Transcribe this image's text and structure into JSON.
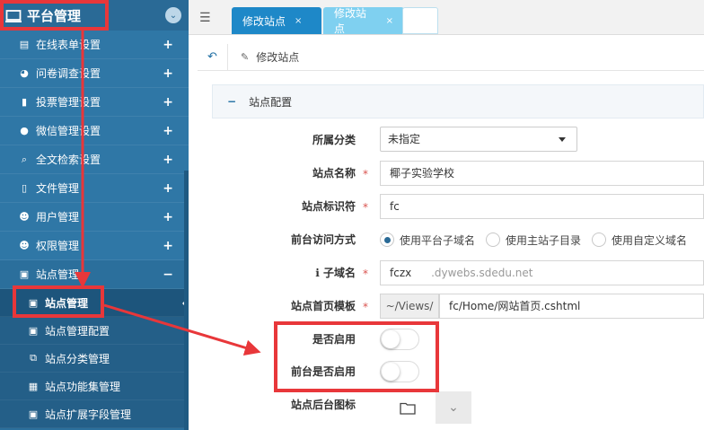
{
  "sidebar": {
    "title": "平台管理",
    "menu": [
      {
        "label": "在线表单设置",
        "icon": "form-icon",
        "glyph": "▤",
        "expand": "+"
      },
      {
        "label": "问卷调查设置",
        "icon": "pie-chart-icon",
        "glyph": "◕",
        "expand": "+"
      },
      {
        "label": "投票管理设置",
        "icon": "bar-chart-icon",
        "glyph": "▮",
        "expand": "+"
      },
      {
        "label": "微信管理设置",
        "icon": "wechat-icon",
        "glyph": "●",
        "expand": "+"
      },
      {
        "label": "全文检索设置",
        "icon": "search-icon",
        "glyph": "⌕",
        "expand": "+"
      },
      {
        "label": "文件管理",
        "icon": "file-icon",
        "glyph": "▯",
        "expand": "+"
      },
      {
        "label": "用户管理",
        "icon": "user-icon",
        "glyph": "☻",
        "expand": "+"
      },
      {
        "label": "权限管理",
        "icon": "permission-icon",
        "glyph": "☻",
        "expand": "+"
      },
      {
        "label": "站点管理",
        "icon": "site-icon",
        "glyph": "▣",
        "expand": "−"
      }
    ],
    "submenu": [
      {
        "label": "站点管理",
        "icon": "site-manage-icon",
        "glyph": "▣"
      },
      {
        "label": "站点管理配置",
        "icon": "site-config-icon",
        "glyph": "▣"
      },
      {
        "label": "站点分类管理",
        "icon": "category-icon",
        "glyph": "⧉"
      },
      {
        "label": "站点功能集管理",
        "icon": "grid-icon",
        "glyph": "▦"
      },
      {
        "label": "站点扩展字段管理",
        "icon": "extend-field-icon",
        "glyph": "▣"
      }
    ]
  },
  "tabs": [
    {
      "label": "修改站点",
      "close": "×"
    },
    {
      "label": "修改站点",
      "close": "×"
    }
  ],
  "breadcrumb": {
    "title": "修改站点"
  },
  "panel": {
    "title": "站点配置",
    "collapse": "−"
  },
  "form": {
    "category_label": "所属分类",
    "category_value": "未指定",
    "name_label": "站点名称",
    "name_value": "椰子实验学校",
    "identifier_label": "站点标识符",
    "identifier_value": "fc",
    "access_label": "前台访问方式",
    "access_options": [
      "使用平台子域名",
      "使用主站子目录",
      "使用自定义域名"
    ],
    "access_selected": 0,
    "subdomain_label": "子域名",
    "subdomain_value": "fczx",
    "subdomain_suffix": ".dywebs.sdedu.net",
    "template_label": "站点首页模板",
    "template_prefix": "~/Views/",
    "template_value": "fc/Home/网站首页.cshtml",
    "enabled_label": "是否启用",
    "enabled_value": false,
    "front_enabled_label": "前台是否启用",
    "front_enabled_value": false,
    "backend_icon_label": "站点后台图标",
    "required_mark": "*",
    "info_mark": "ℹ"
  },
  "colors": {
    "sidebar": "#2b6f9c",
    "accent": "#1e88c8",
    "annotation": "#e8373a"
  }
}
